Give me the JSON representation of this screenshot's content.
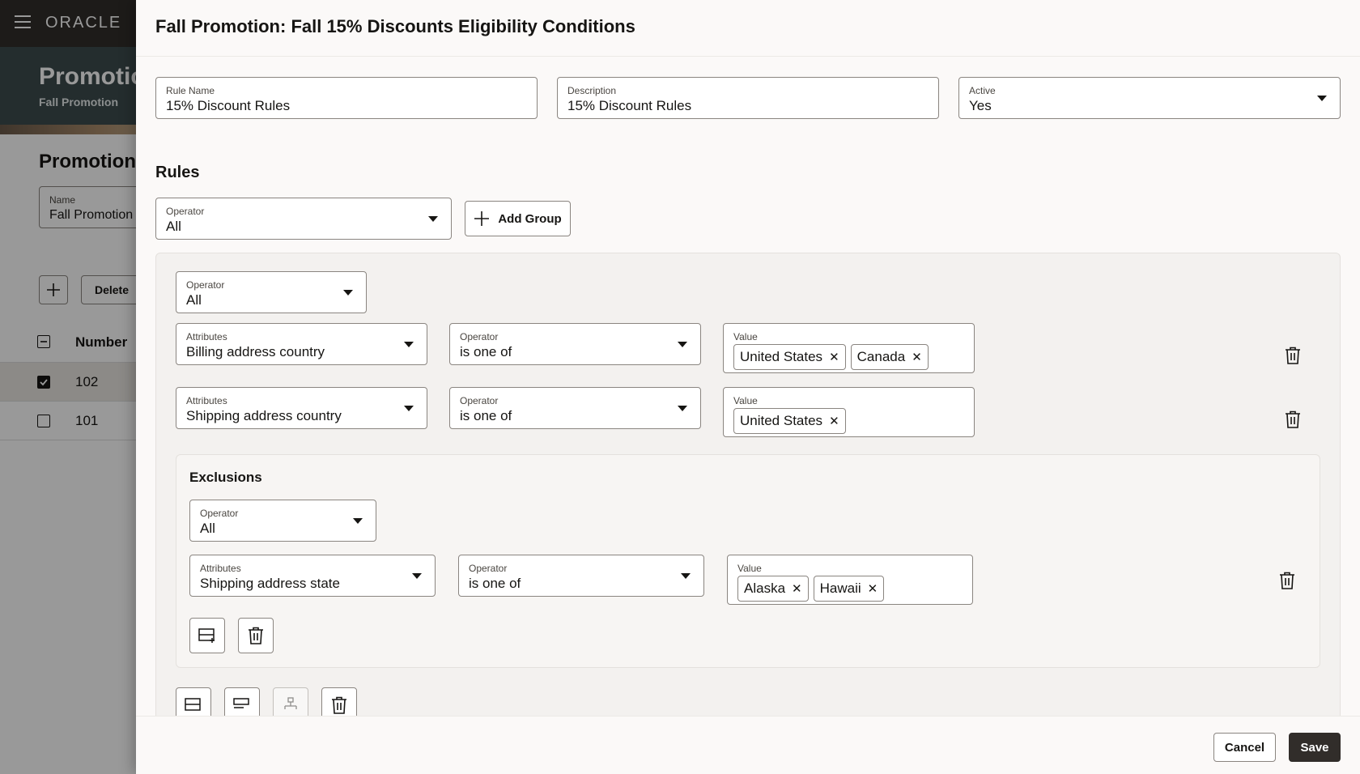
{
  "background": {
    "logo": "ORACLE",
    "hero_title": "Promotion",
    "hero_subtitle": "Fall Promotion",
    "section_title": "Promotion",
    "name_field": {
      "label": "Name",
      "value": "Fall Promotion"
    },
    "delete_label": "Delete",
    "table": {
      "column_number": "Number",
      "rows": [
        {
          "number": "102",
          "selected": true
        },
        {
          "number": "101",
          "selected": false
        }
      ]
    }
  },
  "drawer": {
    "title": "Fall Promotion: Fall 15% Discounts Eligibility Conditions",
    "rule_name": {
      "label": "Rule Name",
      "value": "15% Discount Rules"
    },
    "description": {
      "label": "Description",
      "value": "15% Discount Rules"
    },
    "active": {
      "label": "Active",
      "value": "Yes"
    },
    "rules_title": "Rules",
    "top_operator": {
      "label": "Operator",
      "value": "All"
    },
    "add_group_label": "Add Group",
    "group": {
      "operator": {
        "label": "Operator",
        "value": "All"
      },
      "conditions": [
        {
          "attribute": {
            "label": "Attributes",
            "value": "Billing address country"
          },
          "operator": {
            "label": "Operator",
            "value": "is one of"
          },
          "value_label": "Value",
          "values": [
            "United States",
            "Canada"
          ]
        },
        {
          "attribute": {
            "label": "Attributes",
            "value": "Shipping address country"
          },
          "operator": {
            "label": "Operator",
            "value": "is one of"
          },
          "value_label": "Value",
          "values": [
            "United States"
          ]
        }
      ],
      "exclusions": {
        "title": "Exclusions",
        "operator": {
          "label": "Operator",
          "value": "All"
        },
        "condition": {
          "attribute": {
            "label": "Attributes",
            "value": "Shipping address state"
          },
          "operator": {
            "label": "Operator",
            "value": "is one of"
          },
          "value_label": "Value",
          "values": [
            "Alaska",
            "Hawaii"
          ]
        }
      }
    },
    "cancel_label": "Cancel",
    "save_label": "Save"
  }
}
